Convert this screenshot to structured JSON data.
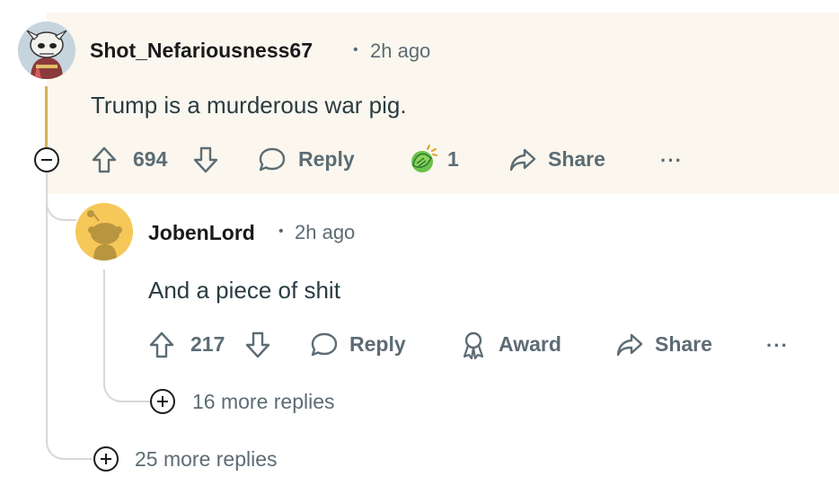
{
  "comment1": {
    "username": "Shot_Nefariousness67",
    "separator": "•",
    "time": "2h ago",
    "body": "Trump is a murderous war pig.",
    "upvotes": "694",
    "reply_label": "Reply",
    "award_count": "1",
    "share_label": "Share",
    "more": "···",
    "collapse_icon": "minus-circle-icon",
    "award_icon": "hands-award-icon"
  },
  "comment2": {
    "username": "JobenLord",
    "separator": "•",
    "time": "2h ago",
    "body": "And a piece of shit",
    "upvotes": "217",
    "reply_label": "Reply",
    "award_label": "Award",
    "share_label": "Share",
    "more": "···"
  },
  "more_replies_inner": "16 more replies",
  "more_replies_outer": "25 more replies",
  "colors": {
    "highlight_bg": "#fbf7ee",
    "thread_line_active": "#d4b25a",
    "thread_line": "#d7d7d7",
    "muted_text": "#5c6c74",
    "body_text": "#2a3c42",
    "avatar2_bg": "#f6c85a"
  }
}
